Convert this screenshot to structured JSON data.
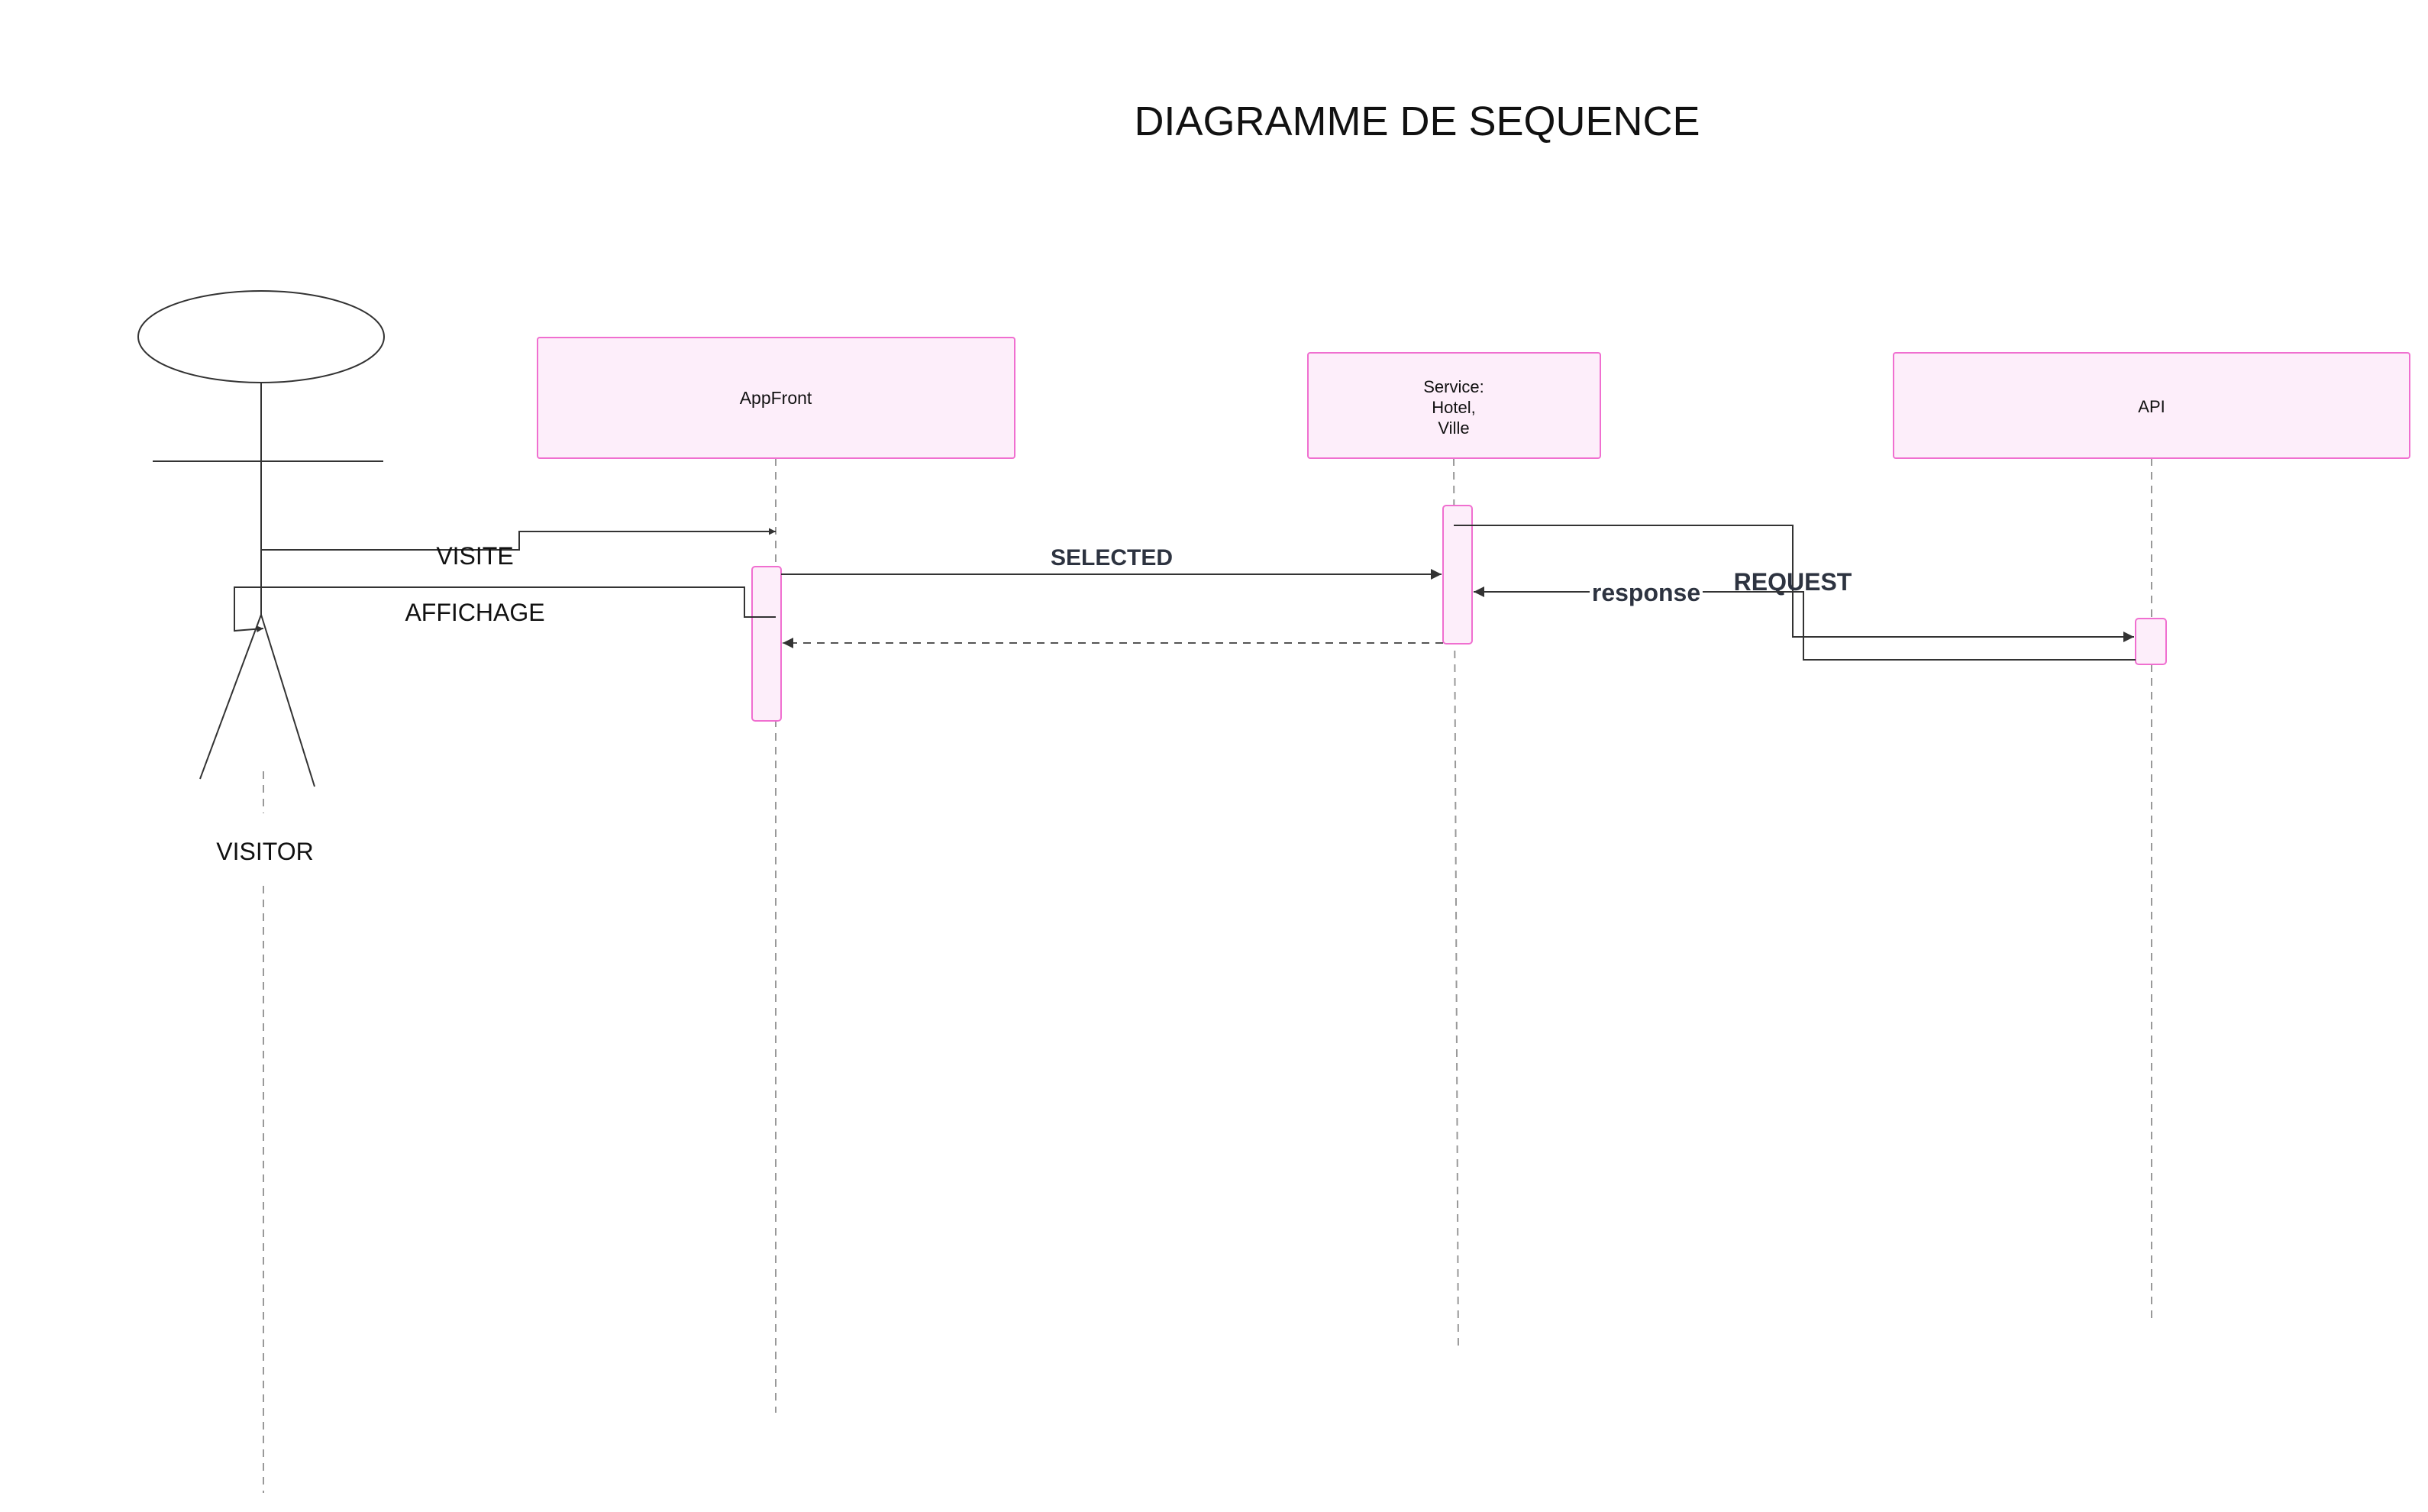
{
  "title": "DIAGRAMME DE SEQUENCE",
  "colors": {
    "participant_fill": "#fdeefa",
    "participant_stroke": "#f06fd0",
    "line": "#333333",
    "lifeline": "#999999",
    "label_bold": "#2d3340"
  },
  "actor": {
    "label": "VISITOR"
  },
  "participants": {
    "appfront": {
      "label": "AppFront"
    },
    "service": {
      "line1": "Service:",
      "line2": "Hotel,",
      "line3": "Ville"
    },
    "api": {
      "label": "API"
    }
  },
  "messages": {
    "visite": "VISITE",
    "affichage": "AFFICHAGE",
    "selected": "SELECTED",
    "response": "response",
    "request": "REQUEST"
  }
}
